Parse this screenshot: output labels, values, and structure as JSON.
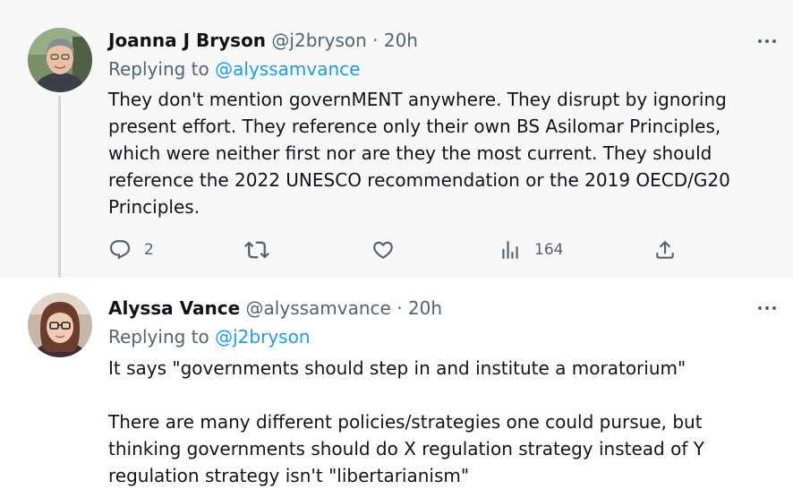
{
  "tweets": [
    {
      "display_name": "Joanna J Bryson",
      "handle": "@j2bryson",
      "separator": "·",
      "time": "20h",
      "replying_prefix": "Replying to",
      "replying_to": "@alyssamvance",
      "body": [
        "They don't mention governMENT anywhere. They disrupt by ignoring present effort. They reference only their own BS Asilomar Principles, which were neither first nor are they the most current. They should reference the 2022 UNESCO recommendation or the 2019 OECD/G20 Principles."
      ],
      "stats": {
        "replies": "2",
        "views": "164"
      }
    },
    {
      "display_name": "Alyssa Vance",
      "handle": "@alyssamvance",
      "separator": "·",
      "time": "20h",
      "replying_prefix": "Replying to",
      "replying_to": "@j2bryson",
      "body": [
        "It says \"governments should step in and institute a moratorium\"",
        "There are many different policies/strategies one could pursue, but thinking governments should do X regulation strategy instead of Y regulation strategy isn't \"libertarianism\""
      ]
    }
  ],
  "icons": {
    "reply": "reply-icon",
    "retweet": "retweet-icon",
    "like": "heart-icon",
    "views": "views-icon",
    "share": "share-icon",
    "more": "more-icon"
  },
  "colors": {
    "link": "#1d9bf0",
    "secondary_text": "#536471",
    "primary_text": "#0f1419",
    "highlight_background": "#f7f7f7"
  }
}
